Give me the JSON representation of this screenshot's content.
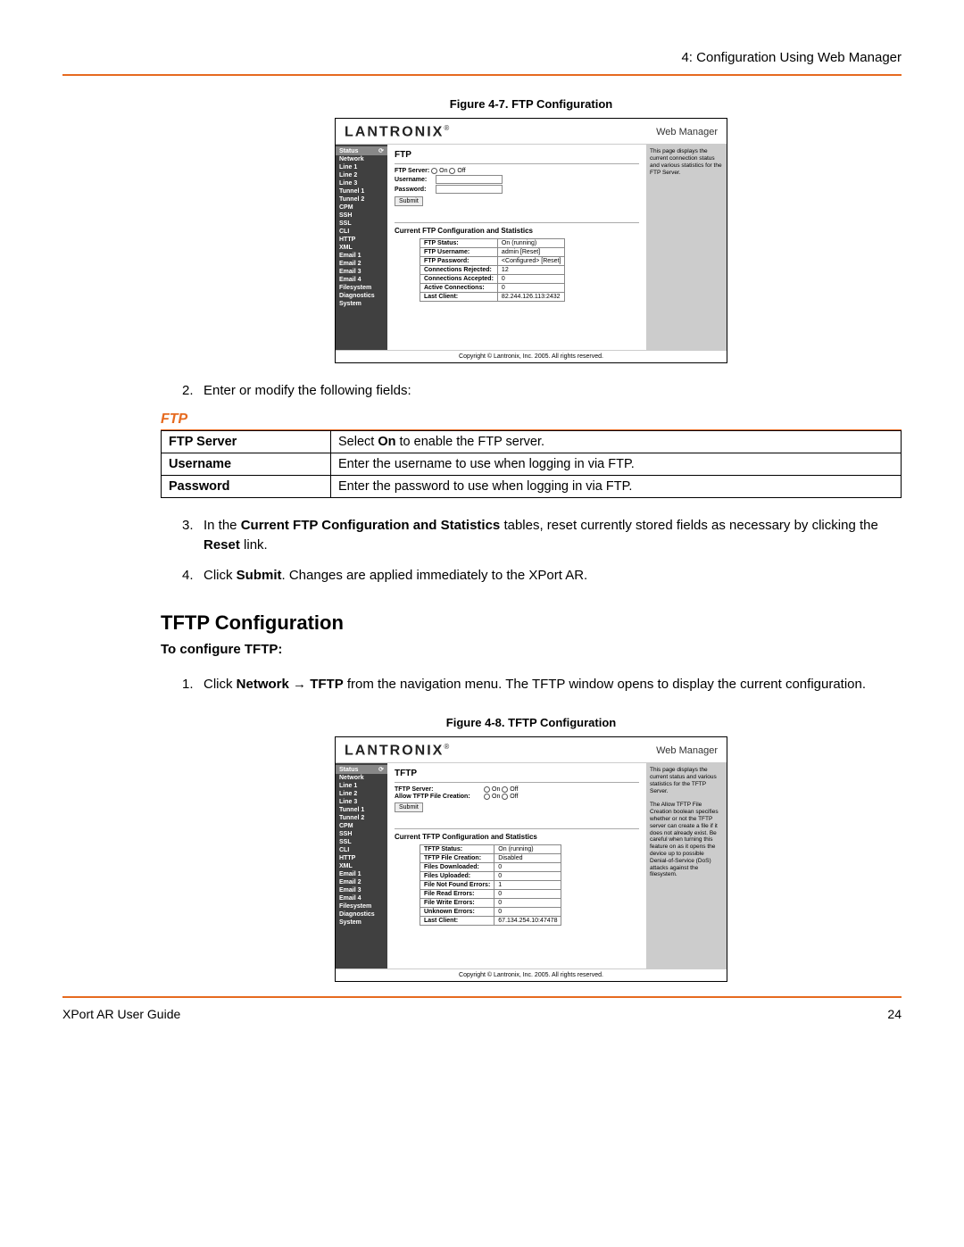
{
  "header": {
    "chapter": "4: Configuration Using Web Manager"
  },
  "footer": {
    "guide": "XPort AR User Guide",
    "page": "24"
  },
  "fig1": {
    "caption": "Figure 4-7. FTP Configuration",
    "brand": "LANTRONIX",
    "wm": "Web Manager",
    "nav": [
      "Status",
      "Network",
      "Line 1",
      "Line 2",
      "Line 3",
      "Tunnel 1",
      "Tunnel 2",
      "CPM",
      "SSH",
      "SSL",
      "CLI",
      "HTTP",
      "XML",
      "Email 1",
      "Email 2",
      "Email 3",
      "Email 4",
      "Filesystem",
      "Diagnostics",
      "System"
    ],
    "title": "FTP",
    "serverLabel": "FTP Server:",
    "on": "On",
    "off": "Off",
    "userLabel": "Username:",
    "passLabel": "Password:",
    "submit": "Submit",
    "statsHead": "Current FTP Configuration and Statistics",
    "rows": [
      [
        "FTP Status:",
        "On (running)"
      ],
      [
        "FTP Username:",
        "admin [Reset]"
      ],
      [
        "FTP Password:",
        "<Configured> [Reset]"
      ],
      [
        "Connections Rejected:",
        "12"
      ],
      [
        "Connections Accepted:",
        "0"
      ],
      [
        "Active Connections:",
        "0"
      ],
      [
        "Last Client:",
        "82.244.126.113:2432"
      ]
    ],
    "sidehelp": "This page displays the current connection status and various statistics for the FTP Server.",
    "copy": "Copyright © Lantronix, Inc. 2005. All rights reserved."
  },
  "step2": "Enter or modify the following fields:",
  "sec1": "FTP",
  "tbl1": [
    {
      "f": "FTP Server",
      "a": "Select ",
      "b": "On",
      "c": " to enable the FTP server."
    },
    {
      "f": "Username",
      "a": "Enter the username to use when logging in via FTP.",
      "b": "",
      "c": ""
    },
    {
      "f": "Password",
      "a": "Enter the password to use when logging in via FTP.",
      "b": "",
      "c": ""
    }
  ],
  "step3": {
    "a": "In the ",
    "b": "Current FTP Configuration and Statistics",
    "c": " tables, reset currently stored fields as necessary by clicking the ",
    "d": "Reset",
    "e": " link."
  },
  "step4": {
    "a": "Click ",
    "b": "Submit",
    "c": ". Changes are applied immediately to the XPort AR."
  },
  "h2": "TFTP Configuration",
  "h3": "To configure TFTP:",
  "tstep1": {
    "a": "Click ",
    "b": "Network",
    "c": " → ",
    "d": "TFTP",
    "e": " from the navigation menu. The TFTP window opens to display the current configuration."
  },
  "fig2": {
    "caption": "Figure 4-8. TFTP Configuration",
    "title": "TFTP",
    "serverLabel": "TFTP Server:",
    "allowLabel": "Allow TFTP File Creation:",
    "statsHead": "Current TFTP Configuration and Statistics",
    "rows": [
      [
        "TFTP Status:",
        "On (running)"
      ],
      [
        "TFTP File Creation:",
        "Disabled"
      ],
      [
        "Files Downloaded:",
        "0"
      ],
      [
        "Files Uploaded:",
        "0"
      ],
      [
        "File Not Found Errors:",
        "1"
      ],
      [
        "File Read Errors:",
        "0"
      ],
      [
        "File Write Errors:",
        "0"
      ],
      [
        "Unknown Errors:",
        "0"
      ],
      [
        "Last Client:",
        "67.134.254.10:47478"
      ]
    ],
    "sidehelp": "This page displays the current status and various statistics for the TFTP Server.\n\nThe Allow TFTP File Creation boolean specifies whether or not the TFTP server can create a file if it does not already exist. Be careful when turning this feature on as it opens the device up to possible Denial-of-Service (DoS) attacks against the filesystem."
  }
}
